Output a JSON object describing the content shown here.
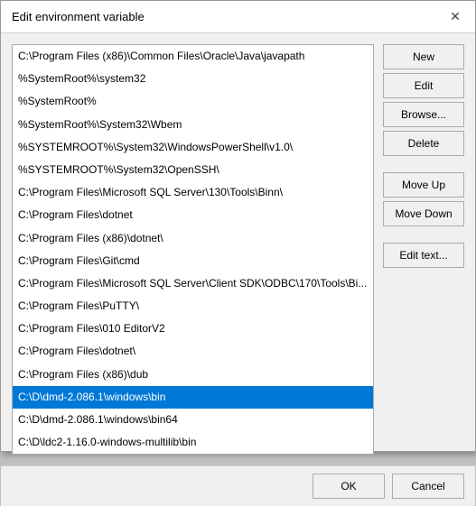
{
  "dialog": {
    "title": "Edit environment variable",
    "close_label": "✕"
  },
  "list": {
    "items": [
      "C:\\Program Files (x86)\\Common Files\\Oracle\\Java\\javapath",
      "%SystemRoot%\\system32",
      "%SystemRoot%",
      "%SystemRoot%\\System32\\Wbem",
      "%SYSTEMROOT%\\System32\\WindowsPowerShell\\v1.0\\",
      "%SYSTEMROOT%\\System32\\OpenSSH\\",
      "C:\\Program Files\\Microsoft SQL Server\\130\\Tools\\Binn\\",
      "C:\\Program Files\\dotnet",
      "C:\\Program Files (x86)\\dotnet\\",
      "C:\\Program Files\\Git\\cmd",
      "C:\\Program Files\\Microsoft SQL Server\\Client SDK\\ODBC\\170\\Tools\\Bi...",
      "C:\\Program Files\\PuTTY\\",
      "C:\\Program Files\\010 EditorV2",
      "C:\\Program Files\\dotnet\\",
      "C:\\Program Files (x86)\\dub",
      "C:\\D\\dmd-2.086.1\\windows\\bin",
      "C:\\D\\dmd-2.086.1\\windows\\bin64",
      "C:\\D\\ldc2-1.16.0-windows-multilib\\bin"
    ],
    "selected_index": 15
  },
  "buttons": {
    "new_label": "New",
    "edit_label": "Edit",
    "browse_label": "Browse...",
    "delete_label": "Delete",
    "move_up_label": "Move Up",
    "move_down_label": "Move Down",
    "edit_text_label": "Edit text..."
  },
  "footer": {
    "ok_label": "OK",
    "cancel_label": "Cancel"
  }
}
